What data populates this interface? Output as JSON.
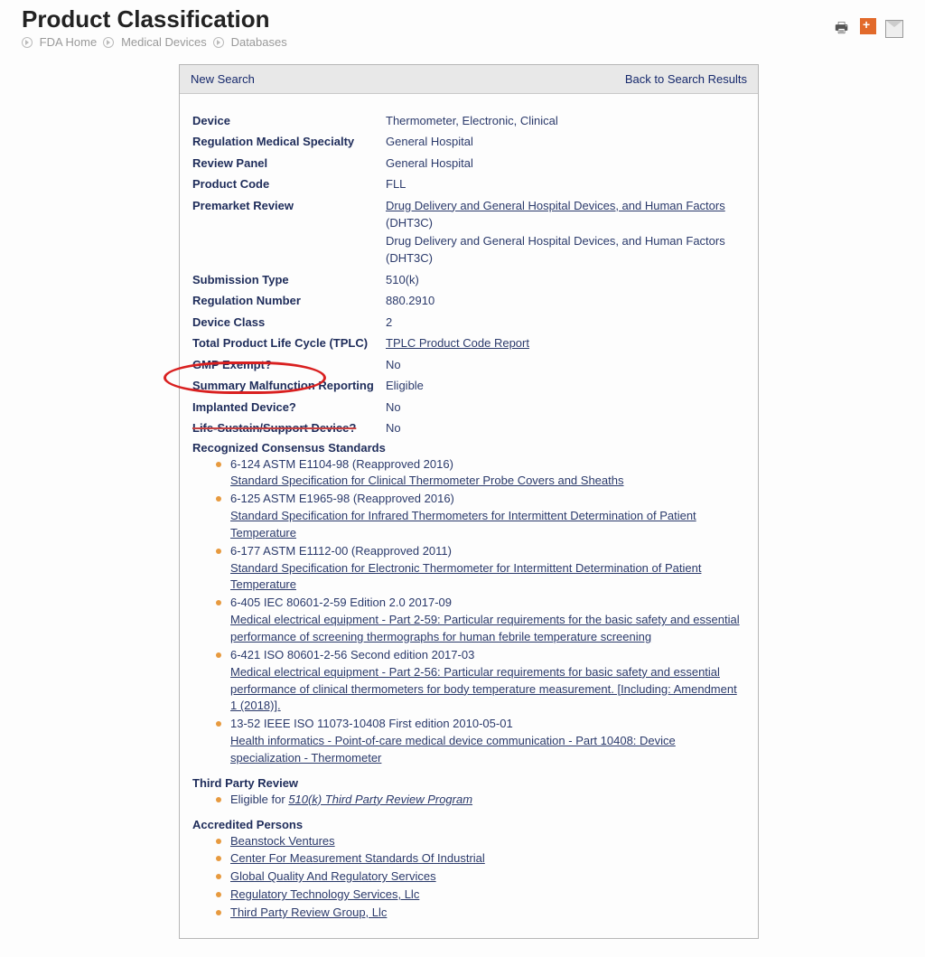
{
  "header": {
    "title": "Product Classification",
    "breadcrumbs": [
      "FDA Home",
      "Medical Devices",
      "Databases"
    ]
  },
  "topbar": {
    "new_search": "New Search",
    "back": "Back to Search Results"
  },
  "fields": {
    "device_lbl": "Device",
    "device_val": "Thermometer, Electronic, Clinical",
    "reg_spec_lbl": "Regulation Medical Specialty",
    "reg_spec_val": "General Hospital",
    "review_panel_lbl": "Review Panel",
    "review_panel_val": "General Hospital",
    "product_code_lbl": "Product Code",
    "product_code_val": "FLL",
    "premarket_lbl": "Premarket Review",
    "premarket_link": "Drug Delivery and General Hospital Devices, and Human Factors",
    "premarket_suffix": " (DHT3C)",
    "premarket_plain": "Drug Delivery and General Hospital Devices, and Human Factors (DHT3C)",
    "subtype_lbl": "Submission Type",
    "subtype_val": "510(k)",
    "regnum_lbl": "Regulation Number",
    "regnum_val": "880.2910",
    "devclass_lbl": "Device Class",
    "devclass_val": "2",
    "tplc_lbl": "Total Product Life Cycle (TPLC)",
    "tplc_val": "TPLC Product Code Report",
    "gmp_lbl": "GMP Exempt?",
    "gmp_val": "No",
    "summary_lbl": "Summary Malfunction Reporting",
    "summary_val": "Eligible",
    "implanted_lbl": "Implanted Device?",
    "implanted_val": "No",
    "lifesustain_lbl": "Life-Sustain/Support Device?",
    "lifesustain_val": "No",
    "rcs_lbl": "Recognized Consensus Standards"
  },
  "standards": {
    "s1_code": "6-124 ASTM E1104-98 (Reapproved 2016)",
    "s1_txt": "Standard Specification for Clinical Thermometer Probe Covers and Sheaths",
    "s2_code": "6-125 ASTM E1965-98 (Reapproved 2016)",
    "s2_txt": "Standard Specification for Infrared Thermometers for Intermittent Determination of Patient Temperature",
    "s3_code": "6-177 ASTM E1112-00 (Reapproved 2011)",
    "s3_txt": "Standard Specification for Electronic Thermometer for Intermittent Determination of Patient Temperature",
    "s4_code": "6-405 IEC 80601-2-59 Edition 2.0 2017-09",
    "s4_txt": "Medical electrical equipment - Part 2-59: Particular requirements for the basic safety and essential performance of screening thermographs for human febrile temperature screening",
    "s5_code": "6-421 ISO 80601-2-56 Second edition 2017-03",
    "s5_txt": "Medical electrical equipment - Part 2-56: Particular requirements for basic safety and essential performance of clinical thermometers for body temperature measurement. [Including: Amendment 1 (2018)].",
    "s6_code": "13-52 IEEE ISO 11073-10408 First edition 2010-05-01",
    "s6_txt": "Health informatics - Point-of-care medical device communication - Part 10408: Device specialization - Thermometer"
  },
  "third_party": {
    "heading": "Third Party Review",
    "prefix": "Eligible for ",
    "link": "510(k) Third Party Review Program"
  },
  "accredited": {
    "heading": "Accredited Persons",
    "p1": "Beanstock Ventures",
    "p2": "Center For Measurement Standards Of Industrial",
    "p3": "Global Quality And Regulatory Services",
    "p4": "Regulatory Technology Services, Llc",
    "p5": "Third Party Review Group, Llc"
  }
}
